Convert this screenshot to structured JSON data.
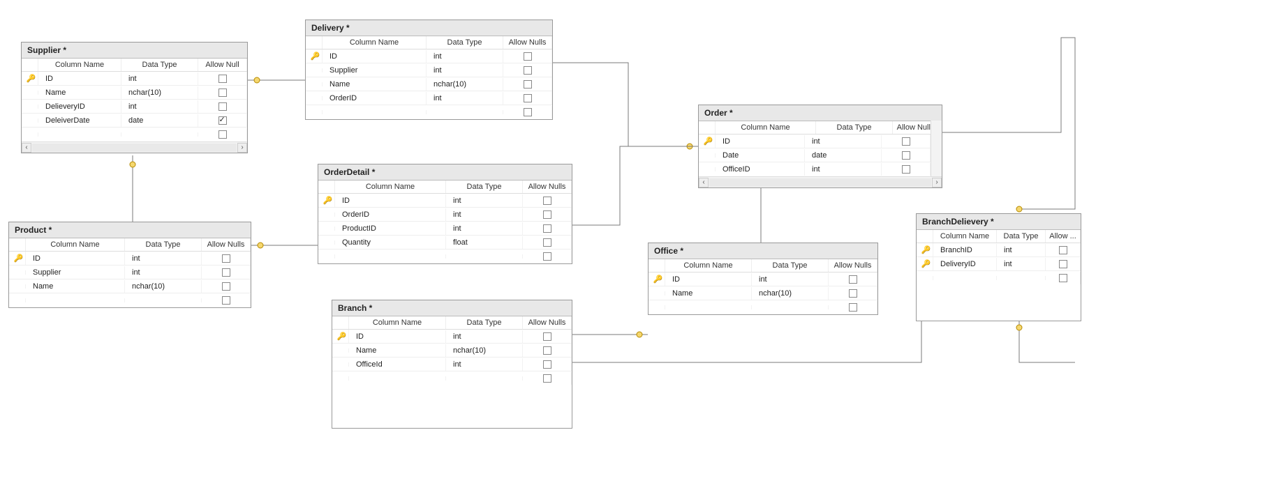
{
  "headers": {
    "column_name": "Column Name",
    "data_type": "Data Type",
    "allow_nulls": "Allow Nulls",
    "allow_nulls_short": "Allow Null",
    "allow_nulls_short2": "Allow Null ˄",
    "allow_ellipsis": "Allow ..."
  },
  "tables": {
    "supplier": {
      "title": "Supplier *",
      "rows": [
        {
          "pk": true,
          "name": "ID",
          "type": "int",
          "null": false
        },
        {
          "pk": false,
          "name": "Name",
          "type": "nchar(10)",
          "null": false
        },
        {
          "pk": false,
          "name": "DelieveryID",
          "type": "int",
          "null": false
        },
        {
          "pk": false,
          "name": "DeleiverDate",
          "type": "date",
          "null": true
        }
      ]
    },
    "delivery": {
      "title": "Delivery *",
      "rows": [
        {
          "pk": true,
          "name": "ID",
          "type": "int",
          "null": false
        },
        {
          "pk": false,
          "name": "Supplier",
          "type": "int",
          "null": false
        },
        {
          "pk": false,
          "name": "Name",
          "type": "nchar(10)",
          "null": false
        },
        {
          "pk": false,
          "name": "OrderID",
          "type": "int",
          "null": false
        }
      ]
    },
    "order": {
      "title": "Order *",
      "rows": [
        {
          "pk": true,
          "name": "ID",
          "type": "int",
          "null": false
        },
        {
          "pk": false,
          "name": "Date",
          "type": "date",
          "null": false
        },
        {
          "pk": false,
          "name": "OfficeID",
          "type": "int",
          "null": false
        }
      ]
    },
    "orderdetail": {
      "title": "OrderDetail *",
      "rows": [
        {
          "pk": true,
          "name": "ID",
          "type": "int",
          "null": false
        },
        {
          "pk": false,
          "name": "OrderID",
          "type": "int",
          "null": false
        },
        {
          "pk": false,
          "name": "ProductID",
          "type": "int",
          "null": false
        },
        {
          "pk": false,
          "name": "Quantity",
          "type": "float",
          "null": false
        }
      ]
    },
    "product": {
      "title": "Product *",
      "rows": [
        {
          "pk": true,
          "name": "ID",
          "type": "int",
          "null": false
        },
        {
          "pk": false,
          "name": "Supplier",
          "type": "int",
          "null": false
        },
        {
          "pk": false,
          "name": "Name",
          "type": "nchar(10)",
          "null": false
        }
      ]
    },
    "office": {
      "title": "Office *",
      "rows": [
        {
          "pk": true,
          "name": "ID",
          "type": "int",
          "null": false
        },
        {
          "pk": false,
          "name": "Name",
          "type": "nchar(10)",
          "null": false
        }
      ]
    },
    "branch": {
      "title": "Branch *",
      "rows": [
        {
          "pk": true,
          "name": "ID",
          "type": "int",
          "null": false
        },
        {
          "pk": false,
          "name": "Name",
          "type": "nchar(10)",
          "null": false
        },
        {
          "pk": false,
          "name": "OfficeId",
          "type": "int",
          "null": false
        }
      ]
    },
    "branchdelievery": {
      "title": "BranchDelievery *",
      "rows": [
        {
          "pk": true,
          "name": "BranchID",
          "type": "int",
          "null": false
        },
        {
          "pk": true,
          "name": "DeliveryID",
          "type": "int",
          "null": false
        }
      ]
    }
  }
}
